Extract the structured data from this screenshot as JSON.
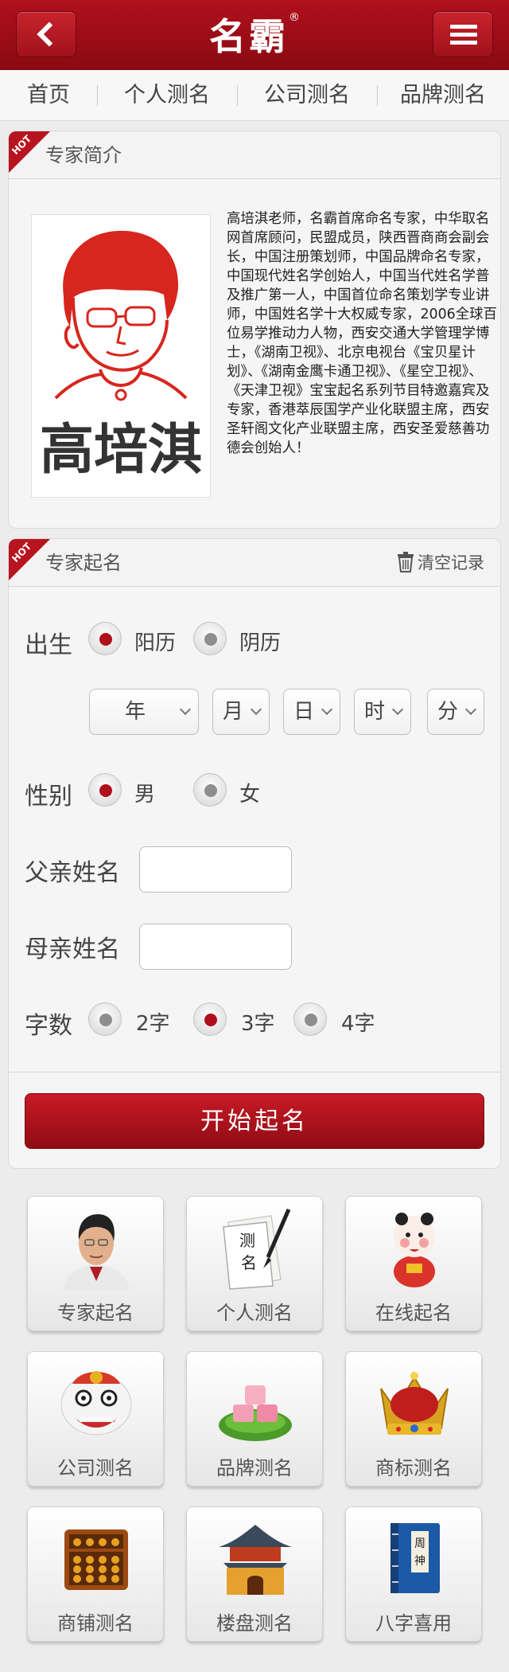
{
  "header": {
    "logo": "名霸",
    "trademark": "®"
  },
  "nav": {
    "items": [
      "首页",
      "个人测名",
      "公司测名",
      "品牌测名"
    ]
  },
  "expert_intro": {
    "badge": "HOT",
    "title": "专家简介",
    "portrait_name": "高培淇",
    "bio": "高培淇老师，名霸首席命名专家，中华取名网首席顾问，民盟成员，陕西晋商商会副会长，中国注册策划师，中国品牌命名专家，中国现代姓名学创始人，中国当代姓名学普及推广第一人，中国首位命名策划学专业讲师，中国姓名学十大权威专家，2006全球百位易学推动力人物，西安交通大学管理学博士，《湖南卫视》、北京电视台《宝贝星计划》、《湖南金鹰卡通卫视》、《星空卫视》、《天津卫视》宝宝起名系列节目特邀嘉宾及专家，香港萃辰国学产业化联盟主席，西安圣轩阁文化产业联盟主席，西安圣爱慈善功德会创始人！"
  },
  "naming_form": {
    "badge": "HOT",
    "title": "专家起名",
    "clear_label": "清空记录",
    "birth_label": "出生",
    "calendar_options": [
      {
        "label": "阳历",
        "selected": true
      },
      {
        "label": "阴历",
        "selected": false
      }
    ],
    "selects": [
      "年",
      "月",
      "日",
      "时",
      "分"
    ],
    "gender_label": "性别",
    "gender_options": [
      {
        "label": "男",
        "selected": true
      },
      {
        "label": "女",
        "selected": false
      }
    ],
    "father_label": "父亲姓名",
    "father_value": "",
    "mother_label": "母亲姓名",
    "mother_value": "",
    "count_label": "字数",
    "count_options": [
      {
        "label": "2字",
        "selected": false
      },
      {
        "label": "3字",
        "selected": true
      },
      {
        "label": "4字",
        "selected": false
      }
    ],
    "submit_label": "开始起名"
  },
  "services": [
    {
      "label": "专家起名",
      "icon": "expert-portrait-icon"
    },
    {
      "label": "个人测名",
      "icon": "calligraphy-paper-icon"
    },
    {
      "label": "在线起名",
      "icon": "baby-doll-icon"
    },
    {
      "label": "公司测名",
      "icon": "lion-dance-icon"
    },
    {
      "label": "品牌测名",
      "icon": "cake-plate-icon"
    },
    {
      "label": "商标测名",
      "icon": "crown-icon"
    },
    {
      "label": "商铺测名",
      "icon": "abacus-icon"
    },
    {
      "label": "楼盘测名",
      "icon": "pagoda-icon"
    },
    {
      "label": "八字喜用",
      "icon": "book-icon"
    }
  ],
  "colors": {
    "brand_red": "#a5101a",
    "panel_bg": "#f5f5f5",
    "page_bg": "#ececec"
  }
}
